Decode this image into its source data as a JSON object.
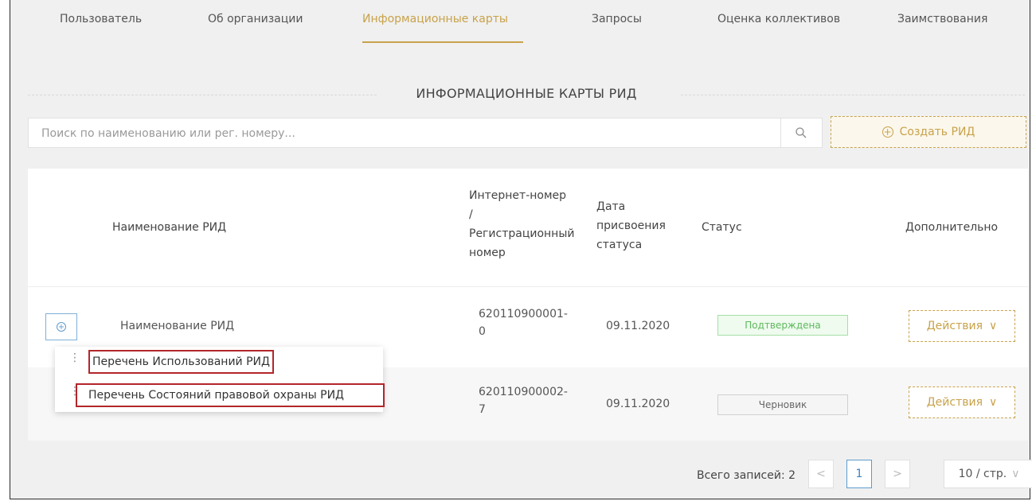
{
  "tabs": [
    {
      "label": "Пользователь"
    },
    {
      "label": "Об организации"
    },
    {
      "label": "Информационные карты"
    },
    {
      "label": "Запросы"
    },
    {
      "label": "Оценка коллективов"
    },
    {
      "label": "Заимствования"
    }
  ],
  "active_tab": "Информационные карты",
  "section_title": "ИНФОРМАЦИОННЫЕ КАРТЫ РИД",
  "search": {
    "placeholder": "Поиск по наименованию или рег. номеру..."
  },
  "create_button": {
    "label": "Создать РИД"
  },
  "table": {
    "headers": {
      "name": "Наименование РИД",
      "number_line1": "Интернет-номер",
      "number_line2": "/",
      "number_line3": "Регистрационный",
      "number_line4": "номер",
      "date_line1": "Дата",
      "date_line2": "присвоения",
      "date_line3": "статуса",
      "status": "Статус",
      "extra": "Дополнительно"
    },
    "rows": [
      {
        "name": "Наименование РИД",
        "number_line1": "620110900001-",
        "number_line2": "0",
        "date": "09.11.2020",
        "status": "Подтверждена",
        "actions": "Действия"
      },
      {
        "name": "",
        "number_line1": "620110900002-",
        "number_line2": "7",
        "date": "09.11.2020",
        "status": "Черновик",
        "actions": "Действия"
      }
    ]
  },
  "context_menu": {
    "items": [
      {
        "label": "Перечень Использований РИД"
      },
      {
        "label": "Перечень Состояний правовой охраны РИД"
      }
    ]
  },
  "pagination": {
    "total_label": "Всего записей: 2",
    "prev": "<",
    "current_page": "1",
    "next": ">",
    "page_size": "10 / стр."
  },
  "colors": {
    "accent": "#c8a24a",
    "link_blue": "#5d9ccd",
    "ok_green": "#5fb85f",
    "highlight_red": "#b3262b"
  }
}
